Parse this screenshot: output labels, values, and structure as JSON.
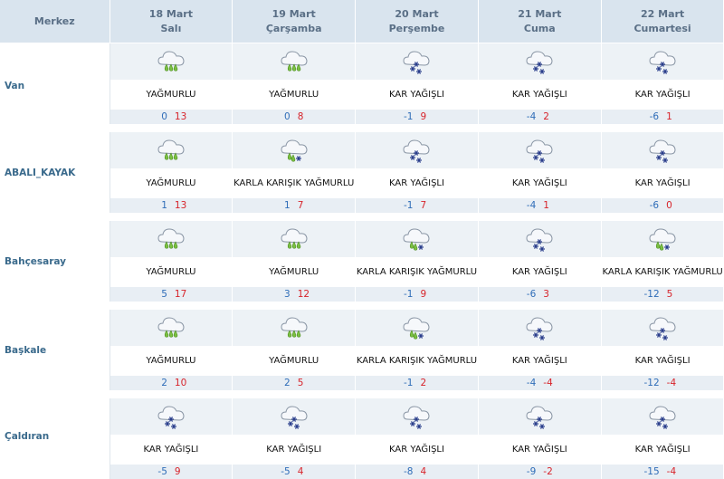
{
  "header": {
    "merkez": "Merkez",
    "days": [
      {
        "date": "18 Mart",
        "day": "Salı"
      },
      {
        "date": "19 Mart",
        "day": "Çarşamba"
      },
      {
        "date": "20 Mart",
        "day": "Perşembe"
      },
      {
        "date": "21 Mart",
        "day": "Cuma"
      },
      {
        "date": "22 Mart",
        "day": "Cumartesi"
      }
    ]
  },
  "colors": {
    "min": "#2f6db8",
    "max": "#d7242b",
    "header_bg": "#d9e4ee",
    "city": "#3a6a8c"
  },
  "rows": [
    {
      "city": "Van",
      "forecasts": [
        {
          "icon": "rain-icon",
          "desc": "YAĞMURLU",
          "min": "0",
          "max": "13"
        },
        {
          "icon": "rain-icon",
          "desc": "YAĞMURLU",
          "min": "0",
          "max": "8"
        },
        {
          "icon": "snow-icon",
          "desc": "KAR YAĞIŞLI",
          "min": "-1",
          "max": "9"
        },
        {
          "icon": "snow-icon",
          "desc": "KAR YAĞIŞLI",
          "min": "-4",
          "max": "2"
        },
        {
          "icon": "snow-icon",
          "desc": "KAR YAĞIŞLI",
          "min": "-6",
          "max": "1"
        }
      ]
    },
    {
      "city": "ABALI_KAYAK",
      "forecasts": [
        {
          "icon": "rain-icon",
          "desc": "YAĞMURLU",
          "min": "1",
          "max": "13"
        },
        {
          "icon": "sleet-icon",
          "desc": "KARLA KARIŞIK YAĞMURLU",
          "min": "1",
          "max": "7"
        },
        {
          "icon": "snow-icon",
          "desc": "KAR YAĞIŞLI",
          "min": "-1",
          "max": "7"
        },
        {
          "icon": "snow-icon",
          "desc": "KAR YAĞIŞLI",
          "min": "-4",
          "max": "1"
        },
        {
          "icon": "snow-icon",
          "desc": "KAR YAĞIŞLI",
          "min": "-6",
          "max": "0"
        }
      ]
    },
    {
      "city": "Bahçesaray",
      "forecasts": [
        {
          "icon": "rain-icon",
          "desc": "YAĞMURLU",
          "min": "5",
          "max": "17"
        },
        {
          "icon": "rain-icon",
          "desc": "YAĞMURLU",
          "min": "3",
          "max": "12"
        },
        {
          "icon": "sleet-icon",
          "desc": "KARLA KARIŞIK YAĞMURLU",
          "min": "-1",
          "max": "9"
        },
        {
          "icon": "snow-icon",
          "desc": "KAR YAĞIŞLI",
          "min": "-6",
          "max": "3"
        },
        {
          "icon": "sleet-icon",
          "desc": "KARLA KARIŞIK YAĞMURLU",
          "min": "-12",
          "max": "5"
        }
      ]
    },
    {
      "city": "Başkale",
      "forecasts": [
        {
          "icon": "rain-icon",
          "desc": "YAĞMURLU",
          "min": "2",
          "max": "10"
        },
        {
          "icon": "rain-icon",
          "desc": "YAĞMURLU",
          "min": "2",
          "max": "5"
        },
        {
          "icon": "sleet-icon",
          "desc": "KARLA KARIŞIK YAĞMURLU",
          "min": "-1",
          "max": "2"
        },
        {
          "icon": "snow-icon",
          "desc": "KAR YAĞIŞLI",
          "min": "-4",
          "max": "-4"
        },
        {
          "icon": "snow-icon",
          "desc": "KAR YAĞIŞLI",
          "min": "-12",
          "max": "-4"
        }
      ]
    },
    {
      "city": "Çaldıran",
      "forecasts": [
        {
          "icon": "snow-icon",
          "desc": "KAR YAĞIŞLI",
          "min": "-5",
          "max": "9"
        },
        {
          "icon": "snow-icon",
          "desc": "KAR YAĞIŞLI",
          "min": "-5",
          "max": "4"
        },
        {
          "icon": "snow-icon",
          "desc": "KAR YAĞIŞLI",
          "min": "-8",
          "max": "4"
        },
        {
          "icon": "snow-icon",
          "desc": "KAR YAĞIŞLI",
          "min": "-9",
          "max": "-2"
        },
        {
          "icon": "snow-icon",
          "desc": "KAR YAĞIŞLI",
          "min": "-15",
          "max": "-4"
        }
      ]
    }
  ]
}
